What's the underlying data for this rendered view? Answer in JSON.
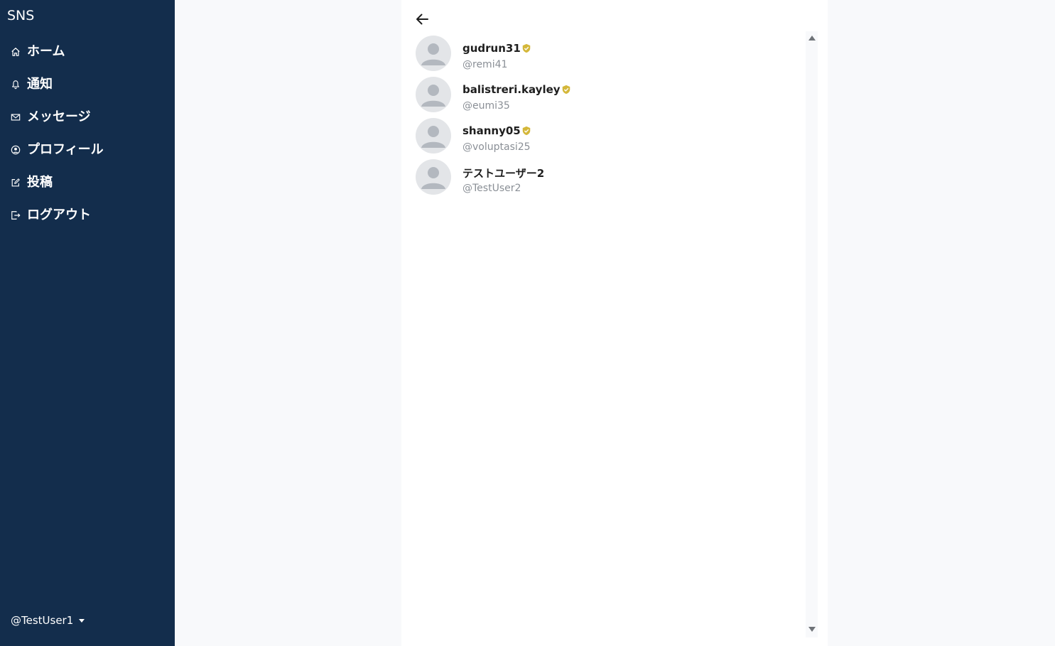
{
  "app": {
    "brand": "SNS"
  },
  "sidebar": {
    "items": [
      {
        "label": "ホーム",
        "icon": "home-icon"
      },
      {
        "label": "通知",
        "icon": "bell-icon"
      },
      {
        "label": "メッセージ",
        "icon": "envelope-icon"
      },
      {
        "label": "プロフィール",
        "icon": "user-circle-icon"
      },
      {
        "label": "投稿",
        "icon": "edit-icon"
      },
      {
        "label": "ログアウト",
        "icon": "logout-icon"
      }
    ],
    "current_user": "@TestUser1"
  },
  "users": [
    {
      "name": "gudrun31",
      "handle": "@remi41",
      "verified": true
    },
    {
      "name": "balistreri.kayley",
      "handle": "@eumi35",
      "verified": true
    },
    {
      "name": "shanny05",
      "handle": "@voluptasi25",
      "verified": true
    },
    {
      "name": "テストユーザー2",
      "handle": "@TestUser2",
      "verified": false
    }
  ],
  "colors": {
    "sidebar_bg": "#132d4c",
    "verified_badge": "#d4b73a",
    "page_bg": "#f8f9fb"
  }
}
